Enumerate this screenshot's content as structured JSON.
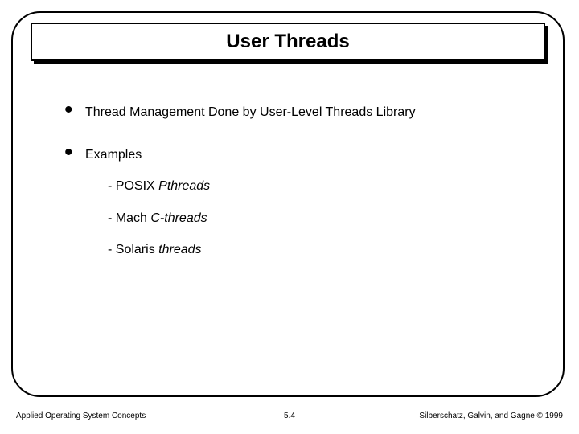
{
  "title": "User Threads",
  "bullets": {
    "b0": "Thread Management Done by User-Level Threads Library",
    "b1": "Examples"
  },
  "examples": {
    "e0": {
      "dash": "- ",
      "prefix": "POSIX ",
      "emph": "Pthreads"
    },
    "e1": {
      "dash": "- ",
      "prefix": "Mach ",
      "emph": "C-threads"
    },
    "e2": {
      "dash": "- ",
      "prefix": "Solaris ",
      "emph": "threads"
    }
  },
  "footer": {
    "left": "Applied Operating System Concepts",
    "center": "5.4",
    "right": "Silberschatz, Galvin, and Gagne © 1999"
  }
}
